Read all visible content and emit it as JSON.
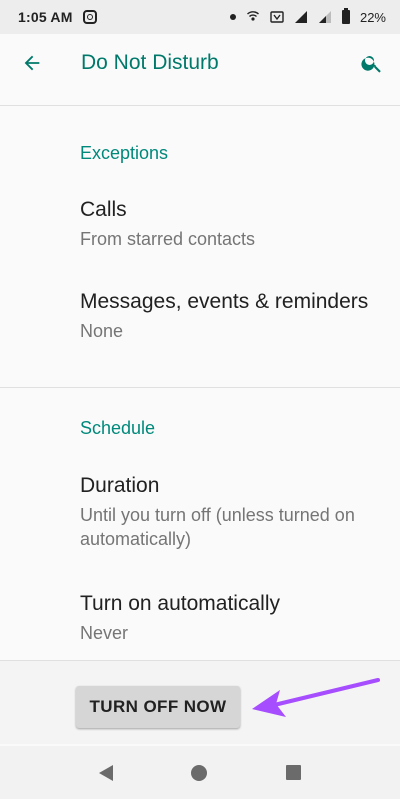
{
  "status_bar": {
    "time": "1:05 AM",
    "battery": "22%"
  },
  "app_bar": {
    "title": "Do Not Disturb"
  },
  "sections": {
    "exceptions": {
      "header": "Exceptions",
      "calls": {
        "title": "Calls",
        "subtitle": "From starred contacts"
      },
      "messages": {
        "title": "Messages, events & reminders",
        "subtitle": "None"
      }
    },
    "schedule": {
      "header": "Schedule",
      "duration": {
        "title": "Duration",
        "subtitle": "Until you turn off (unless turned on automatically)"
      },
      "auto": {
        "title": "Turn on automatically",
        "subtitle": "Never"
      }
    }
  },
  "footer": {
    "turn_off_label": "TURN OFF NOW"
  },
  "colors": {
    "accent": "#00796b",
    "arrow": "#a64dff"
  },
  "icons": [
    "back-arrow-icon",
    "search-icon",
    "instagram-icon",
    "signal-icon",
    "battery-icon",
    "nav-back-icon",
    "nav-home-icon",
    "nav-recents-icon"
  ]
}
